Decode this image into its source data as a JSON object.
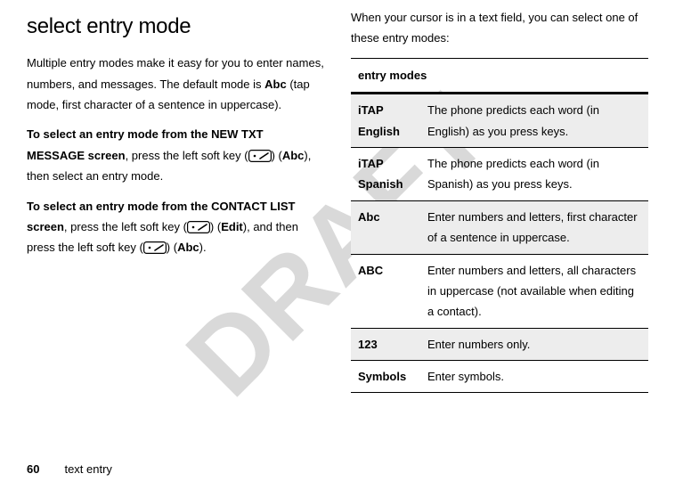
{
  "watermark": "DRAFT",
  "left": {
    "heading": "select entry mode",
    "p1_a": "Multiple entry modes make it easy for you to enter names, numbers, and messages. The default mode is ",
    "p1_abc": "Abc",
    "p1_b": " (tap mode, first character of a sentence in uppercase).",
    "p2_a": "To select an entry mode from the ",
    "p2_new": "NEW TXT MESSAGE",
    "p2_b": " screen",
    "p2_c": ", press the left soft key (",
    "p2_d": ") (",
    "p2_abc": "Abc",
    "p2_e": "), then select an entry mode.",
    "p3_a": "To select an entry mode from the ",
    "p3_contact": "CONTACT LIST",
    "p3_b": " screen",
    "p3_c": ", press the left soft key (",
    "p3_d": ") (",
    "p3_edit": "Edit",
    "p3_e": "), and then press the left soft key (",
    "p3_f": ") (",
    "p3_abc": "Abc",
    "p3_g": ")."
  },
  "right": {
    "intro": "When your cursor is in a text field, you can select one of these entry modes:",
    "table_header": "entry modes",
    "rows": [
      {
        "name": "iTAP English",
        "desc": "The phone predicts each word (in English) as you press keys."
      },
      {
        "name": "iTAP Spanish",
        "desc": "The phone predicts each word (in Spanish) as you press keys."
      },
      {
        "name": "Abc",
        "desc": "Enter numbers and letters, first character of a sentence in uppercase."
      },
      {
        "name": "ABC",
        "desc": "Enter numbers and letters, all characters in uppercase (not available when editing a contact)."
      },
      {
        "name": "123",
        "desc": "Enter numbers only."
      },
      {
        "name": "Symbols",
        "desc": "Enter symbols."
      }
    ]
  },
  "footer": {
    "page": "60",
    "section": "text entry"
  }
}
